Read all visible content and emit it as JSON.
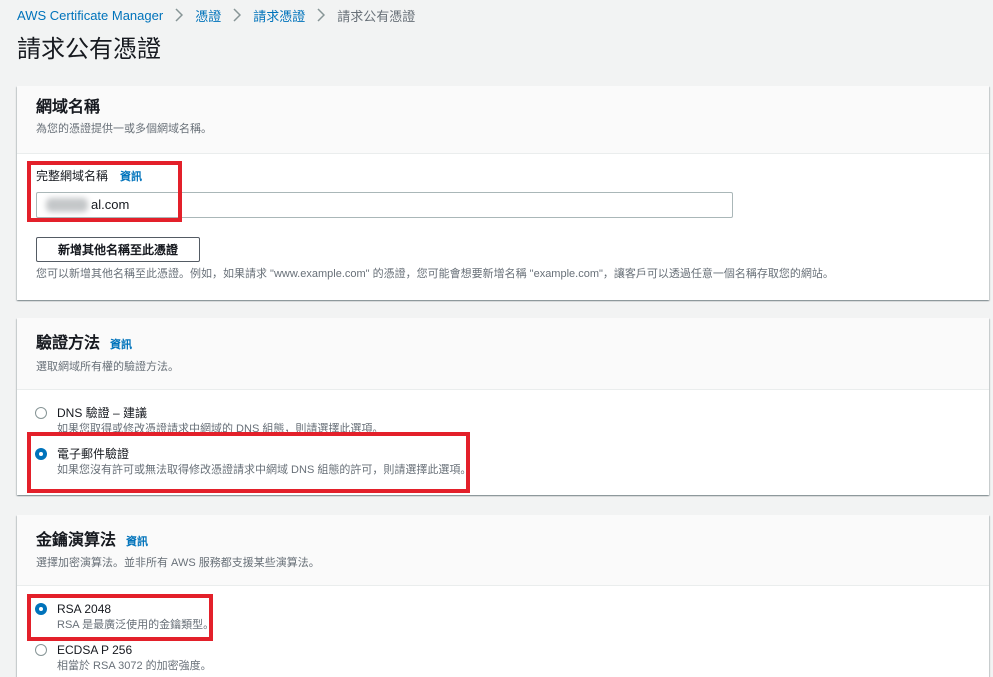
{
  "breadcrumb": {
    "links": [
      "AWS Certificate Manager",
      "憑證",
      "請求憑證"
    ],
    "current": "請求公有憑證",
    "separator_icon": "chevron-right-icon"
  },
  "page_title": "請求公有憑證",
  "domain_names": {
    "title": "網域名稱",
    "description": "為您的憑證提供一或多個網域名稱。",
    "field_label": "完整網域名稱",
    "info_link": "資訊",
    "field_value": "al.com",
    "add_name_button": "新增其他名稱至此憑證",
    "help_text": "您可以新增其他名稱至此憑證。例如，如果請求 \"www.example.com\" 的憑證，您可能會想要新增名稱 \"example.com\"，讓客戶可以透過任意一個名稱存取您的網站。"
  },
  "validation_method": {
    "title": "驗證方法",
    "info_link": "資訊",
    "description": "選取網域所有權的驗證方法。",
    "options": [
      {
        "label": "DNS 驗證 – 建議",
        "description": "如果您取得或修改憑證請求中網域的 DNS 組態，則請選擇此選項。",
        "selected": false
      },
      {
        "label": "電子郵件驗證",
        "description": "如果您沒有許可或無法取得修改憑證請求中網域 DNS 組態的許可，則請選擇此選項。",
        "selected": true
      }
    ]
  },
  "key_algorithm": {
    "title": "金鑰演算法",
    "info_link": "資訊",
    "description": "選擇加密演算法。並非所有 AWS 服務都支援某些演算法。",
    "options": [
      {
        "label": "RSA 2048",
        "description": "RSA 是最廣泛使用的金鑰類型。",
        "selected": true
      },
      {
        "label": "ECDSA P 256",
        "description": "相當於 RSA 3072 的加密強度。",
        "selected": false
      }
    ]
  },
  "colors": {
    "link": "#0073bb",
    "text": "#16191f",
    "secondary_text": "#687078",
    "page_background": "#f2f3f3",
    "radio_selected": "#0073bb",
    "annotation_red": "#e3202a"
  }
}
